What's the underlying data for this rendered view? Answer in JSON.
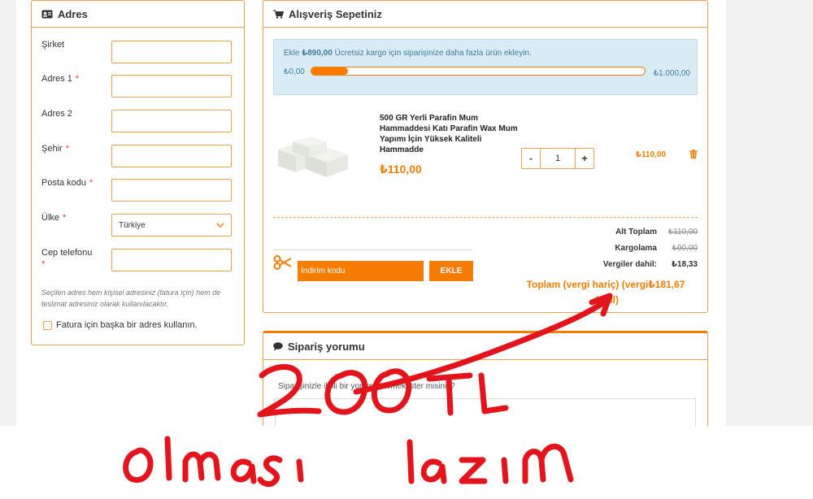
{
  "address": {
    "title": "Adres",
    "fields": [
      {
        "label": "Şirket",
        "required": false,
        "value": ""
      },
      {
        "label": "Adres 1",
        "required": true,
        "value": ""
      },
      {
        "label": "Adres 2",
        "required": false,
        "value": ""
      },
      {
        "label": "Şehir",
        "required": true,
        "value": ""
      },
      {
        "label": "Posta kodu",
        "required": true,
        "value": ""
      },
      {
        "label": "Ülke",
        "required": true,
        "value": "Türkiye"
      },
      {
        "label": "Cep telefonu",
        "required": true,
        "value": ""
      }
    ],
    "required_mark": "*",
    "note": "Seçilen adres hem kişisel adresiniz (fatura için) hem de teslimat adresiniz olarak kullanılacaktır.",
    "billing_checkbox": "Fatura için başka bir adres kullanın."
  },
  "cart": {
    "title": "Alışveriş Sepetiniz",
    "shipping": {
      "prefix": "Ekle",
      "amount": "₺890,00",
      "suffix": "Ücretsiz kargo için siparişinize daha fazla ürün ekleyin.",
      "min": "₺0,00",
      "max": "₺1.000,00",
      "progress": 0.11
    },
    "item": {
      "name": "500 GR Yerli Parafin Mum Hammaddesi Katı Parafin Wax Mum Yapımı İçin Yüksek Kaliteli Hammadde",
      "price": "₺110,00",
      "qty": "1",
      "minus": "-",
      "plus": "+",
      "line_total": "₺110,00"
    },
    "summary": {
      "subtotal_label": "Alt Toplam",
      "subtotal": "₺110,00",
      "shipping_label": "Kargolama",
      "shipping": "₺90,00",
      "tax_label": "Vergiler dahil:",
      "tax": "₺18,33",
      "total_label": "Toplam (vergi hariç) (vergi",
      "total_value": "₺181,67",
      "total_suffix": "dahil)"
    },
    "coupon": {
      "placeholder": "İndirim kodu",
      "button": "EKLE"
    }
  },
  "comment": {
    "title": "Sipariş yorumu",
    "prompt": "Siparişinizle ilgili bir yorum eklemek ister misiniz?"
  },
  "annotation": {
    "color": "#e3141b",
    "note1": "200 TL",
    "note2": "olması lazım"
  },
  "colors": {
    "accent": "#f57c00",
    "border": "#f0a04b",
    "info_bg": "#d9ecf5"
  }
}
